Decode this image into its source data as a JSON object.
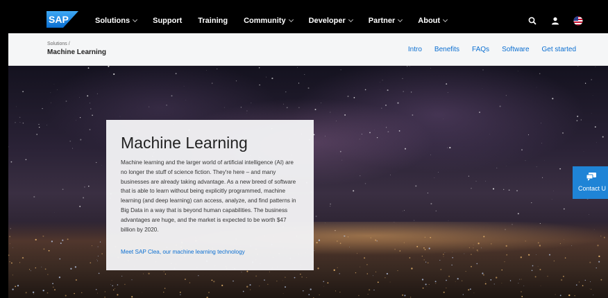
{
  "brand": {
    "logo_text": "SAP",
    "accent": "#0a6ed1"
  },
  "nav": {
    "items": [
      {
        "label": "Solutions",
        "dropdown": true
      },
      {
        "label": "Support",
        "dropdown": false
      },
      {
        "label": "Training",
        "dropdown": false
      },
      {
        "label": "Community",
        "dropdown": true
      },
      {
        "label": "Developer",
        "dropdown": true
      },
      {
        "label": "Partner",
        "dropdown": true
      },
      {
        "label": "About",
        "dropdown": true
      }
    ],
    "icons": [
      "search-icon",
      "user-icon",
      "us-flag-icon"
    ]
  },
  "breadcrumb": {
    "parent": "Solutions /",
    "current": "Machine Learning"
  },
  "subnav": {
    "links": [
      "Intro",
      "Benefits",
      "FAQs",
      "Software",
      "Get started"
    ]
  },
  "card": {
    "title": "Machine Learning",
    "body": "Machine learning and the larger world of artificial intelligence (AI) are no longer the stuff of science fiction. They're here – and many businesses are already taking advantage. As a new breed of software that is able to learn without being explicitly programmed, machine learning (and deep learning) can access, analyze, and find patterns in Big Data in a way that is beyond human capabilities. The business advantages are huge, and the market is expected to be worth $47 billion by 2020.",
    "link": "Meet SAP Clea, our machine learning technology"
  },
  "contact": {
    "label": "Contact U",
    "icon": "chat-icon"
  }
}
